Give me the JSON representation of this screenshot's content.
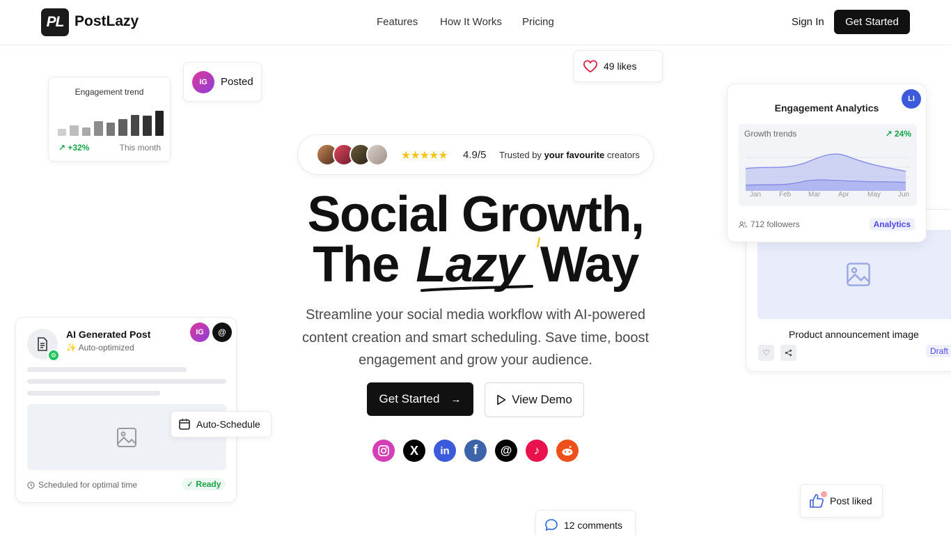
{
  "header": {
    "logo_mark": "PL",
    "brand": "PostLazy",
    "nav": [
      "Features",
      "How It Works",
      "Pricing"
    ],
    "sign_in": "Sign In",
    "get_started": "Get Started"
  },
  "floating": {
    "engagement_trend": {
      "title": "Engagement trend",
      "change": "+32%",
      "period": "This month",
      "bar_levels": [
        0.28,
        0.43,
        0.33,
        0.57,
        0.52,
        0.67,
        0.82,
        0.8,
        1.0
      ]
    },
    "posted": {
      "badge": "IG",
      "label": "Posted"
    },
    "likes": {
      "label": "49 likes"
    },
    "ai_card": {
      "title": "AI Generated Post",
      "subtitle": "Auto-optimized",
      "badge_ig": "IG",
      "badge_threads": "@",
      "schedule": "Scheduled for optimal time",
      "status": "Ready"
    },
    "auto_schedule": {
      "label": "Auto-Schedule"
    },
    "analytics": {
      "title": "Engagement Analytics",
      "badge": "LI",
      "chart_label": "Growth trends",
      "change": "24%",
      "months": [
        "Jan",
        "Feb",
        "Mar",
        "Apr",
        "May",
        "Jun"
      ],
      "followers": "712 followers",
      "tag": "Analytics"
    },
    "product": {
      "caption": "Product announcement image",
      "status": "Draft"
    },
    "post_liked": {
      "label": "Post liked"
    },
    "comments": {
      "label": "12 comments"
    }
  },
  "hero": {
    "stars": "★★★★★",
    "rating": "4.9/5",
    "trusted_prefix": "Trusted by",
    "trusted_bold": "your favourite",
    "trusted_suffix": "creators",
    "title_line1": "Social Growth,",
    "title_the": "The",
    "title_lazy": "Lazy",
    "title_way": "Way",
    "subtitle": "Streamline your social media workflow with AI-powered content creation and smart scheduling. Save time, boost engagement and grow your audience.",
    "cta_primary": "Get Started",
    "cta_secondary": "View Demo"
  },
  "socials": [
    {
      "name": "instagram-icon",
      "color": "#d43fb6"
    },
    {
      "name": "x-icon",
      "color": "#000000"
    },
    {
      "name": "linkedin-icon",
      "color": "#3b5bdb"
    },
    {
      "name": "facebook-icon",
      "color": "#3d64a8"
    },
    {
      "name": "threads-icon",
      "color": "#000000"
    },
    {
      "name": "tiktok-icon",
      "color": "#e9124d"
    },
    {
      "name": "reddit-icon",
      "color": "#ef4f1a"
    }
  ]
}
